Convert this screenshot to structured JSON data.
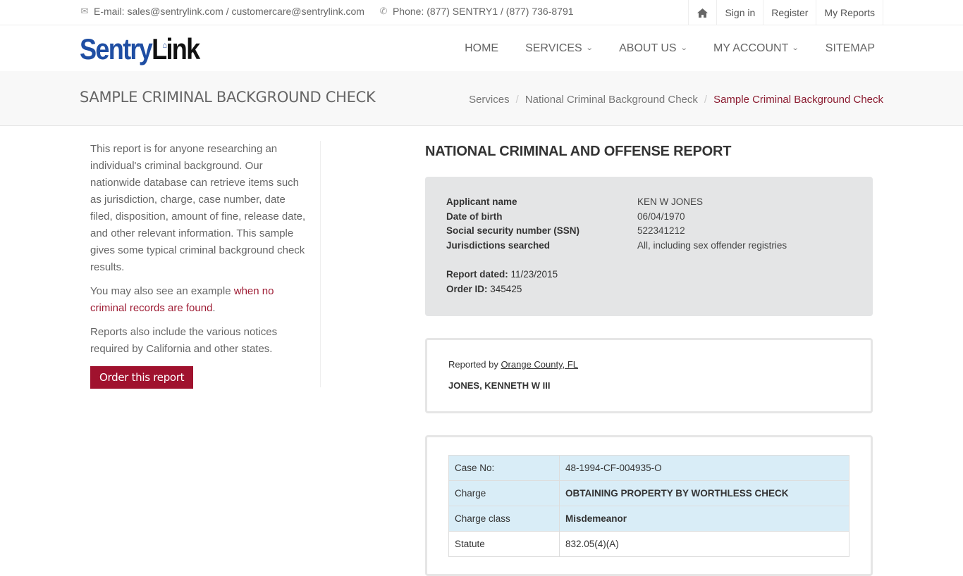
{
  "topbar": {
    "email_label": "E-mail: sales@sentrylink.com / customercare@sentrylink.com",
    "phone_label": "Phone: (877) SENTRY1 / (877) 736-8791",
    "links": {
      "sign_in": "Sign in",
      "register": "Register",
      "my_reports": "My Reports"
    }
  },
  "logo": {
    "part1": "Sentry",
    "part2": "Link"
  },
  "nav": [
    {
      "label": "HOME",
      "dropdown": false
    },
    {
      "label": "SERVICES",
      "dropdown": true
    },
    {
      "label": "ABOUT US",
      "dropdown": true
    },
    {
      "label": "MY ACCOUNT",
      "dropdown": true
    },
    {
      "label": "SITEMAP",
      "dropdown": false
    }
  ],
  "page_title": "SAMPLE CRIMINAL BACKGROUND CHECK",
  "breadcrumb": [
    "Services",
    "National Criminal Background Check",
    "Sample Criminal Background Check"
  ],
  "sidebar": {
    "intro": "This report is for anyone researching an individual's criminal background. Our nationwide database can retrieve items such as jurisdiction, charge, case number, date filed, disposition, amount of fine, release date, and other relevant information. This sample gives some typical criminal background check results.",
    "example_prefix": "You may also see an example ",
    "example_link": "when no criminal records are found",
    "example_suffix": ".",
    "notices": "Reports also include the various notices required by California and other states.",
    "order_button": "Order this report"
  },
  "report": {
    "title": "NATIONAL CRIMINAL AND OFFENSE REPORT",
    "summary": [
      {
        "label": "Applicant name",
        "value": "KEN W JONES"
      },
      {
        "label": "Date of birth",
        "value": "06/04/1970"
      },
      {
        "label": "Social security number (SSN)",
        "value": "522341212"
      },
      {
        "label": "Jurisdictions searched",
        "value": "All, including sex offender registries"
      }
    ],
    "report_dated_label": "Report dated:",
    "report_dated": "11/23/2015",
    "order_id_label": "Order ID:",
    "order_id": "345425",
    "reported_by_prefix": "Reported by ",
    "reported_by": "Orange County, FL",
    "subject_name": "JONES, KENNETH W III",
    "record": [
      {
        "label": "Case No:",
        "value": "48-1994-CF-004935-O",
        "highlight": true,
        "bold": false
      },
      {
        "label": "Charge",
        "value": "OBTAINING PROPERTY BY WORTHLESS CHECK",
        "highlight": true,
        "bold": true
      },
      {
        "label": "Charge class",
        "value": "Misdemeanor",
        "highlight": true,
        "bold": true
      },
      {
        "label": "Statute",
        "value": "832.05(4)(A)",
        "highlight": false,
        "bold": false
      }
    ]
  },
  "colors": {
    "brand_blue": "#1f4ea3",
    "accent_red": "#a0122e",
    "link_red": "#9e1c34",
    "info_blue": "#d9edf7"
  }
}
